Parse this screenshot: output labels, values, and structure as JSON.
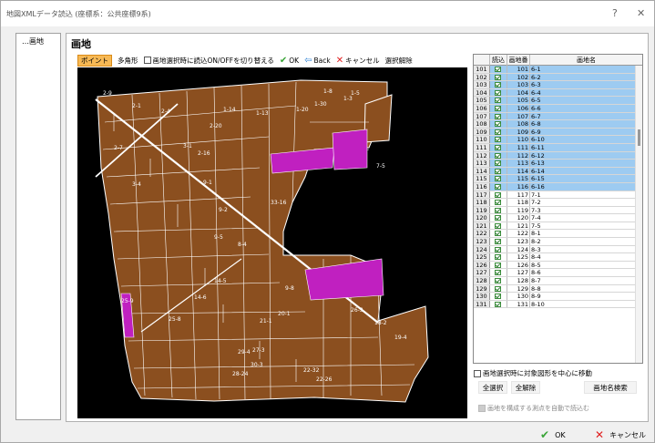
{
  "window": {
    "title": "地図XMLデータ読込 (座標系：公共座標9系)",
    "help_label": "?",
    "close_label": "✕"
  },
  "tree": {
    "item": "…画地"
  },
  "panel": {
    "title": "画地"
  },
  "toolbar": {
    "point": "ポイント",
    "polygon": "多角形",
    "toggle_label": "画地選択時に読込ON/OFFを切り替える",
    "ok": "OK",
    "back": "Back",
    "cancel": "キャンセル",
    "clear": "選択解除"
  },
  "grid": {
    "headers": [
      "読込",
      "画地番号",
      "画地名"
    ],
    "rows": [
      {
        "idx": "101",
        "num": "101",
        "name": "6-1",
        "sel": true
      },
      {
        "idx": "102",
        "num": "102",
        "name": "6-2",
        "sel": true
      },
      {
        "idx": "103",
        "num": "103",
        "name": "6-3",
        "sel": true
      },
      {
        "idx": "104",
        "num": "104",
        "name": "6-4",
        "sel": true
      },
      {
        "idx": "105",
        "num": "105",
        "name": "6-5",
        "sel": true
      },
      {
        "idx": "106",
        "num": "106",
        "name": "6-6",
        "sel": true
      },
      {
        "idx": "107",
        "num": "107",
        "name": "6-7",
        "sel": true
      },
      {
        "idx": "108",
        "num": "108",
        "name": "6-8",
        "sel": true
      },
      {
        "idx": "109",
        "num": "109",
        "name": "6-9",
        "sel": true
      },
      {
        "idx": "110",
        "num": "110",
        "name": "6-10",
        "sel": true
      },
      {
        "idx": "111",
        "num": "111",
        "name": "6-11",
        "sel": true
      },
      {
        "idx": "112",
        "num": "112",
        "name": "6-12",
        "sel": true
      },
      {
        "idx": "113",
        "num": "113",
        "name": "6-13",
        "sel": true
      },
      {
        "idx": "114",
        "num": "114",
        "name": "6-14",
        "sel": true
      },
      {
        "idx": "115",
        "num": "115",
        "name": "6-15",
        "sel": true
      },
      {
        "idx": "116",
        "num": "116",
        "name": "6-16",
        "sel": true
      },
      {
        "idx": "117",
        "num": "117",
        "name": "7-1",
        "sel": false
      },
      {
        "idx": "118",
        "num": "118",
        "name": "7-2",
        "sel": false
      },
      {
        "idx": "119",
        "num": "119",
        "name": "7-3",
        "sel": false
      },
      {
        "idx": "120",
        "num": "120",
        "name": "7-4",
        "sel": false
      },
      {
        "idx": "121",
        "num": "121",
        "name": "7-5",
        "sel": false
      },
      {
        "idx": "122",
        "num": "122",
        "name": "8-1",
        "sel": false
      },
      {
        "idx": "123",
        "num": "123",
        "name": "8-2",
        "sel": false
      },
      {
        "idx": "124",
        "num": "124",
        "name": "8-3",
        "sel": false
      },
      {
        "idx": "125",
        "num": "125",
        "name": "8-4",
        "sel": false
      },
      {
        "idx": "126",
        "num": "126",
        "name": "8-5",
        "sel": false
      },
      {
        "idx": "127",
        "num": "127",
        "name": "8-6",
        "sel": false
      },
      {
        "idx": "128",
        "num": "128",
        "name": "8-7",
        "sel": false
      },
      {
        "idx": "129",
        "num": "129",
        "name": "8-8",
        "sel": false
      },
      {
        "idx": "130",
        "num": "130",
        "name": "8-9",
        "sel": false
      },
      {
        "idx": "131",
        "num": "131",
        "name": "8-10",
        "sel": false
      }
    ]
  },
  "options": {
    "center_label": "画地選択時に対象図形を中心に移動",
    "select_all": "全選択",
    "deselect_all": "全解除",
    "search": "画地名検索",
    "auto_read": "画地を構成する測点を自動で読込む"
  },
  "footer": {
    "ok": "OK",
    "cancel": "キャンセル"
  },
  "map_labels": [
    "2-9",
    "2-1",
    "1-14",
    "1-13",
    "1-20",
    "1-30",
    "1-3",
    "1-8",
    "1-5",
    "2-7",
    "2-20",
    "2-16",
    "2-4",
    "3-1",
    "3-4",
    "9-1",
    "9-2",
    "9-5",
    "8-4",
    "14-6",
    "14-5",
    "9-8",
    "7-5",
    "25-8",
    "25-9",
    "21-1",
    "20-1",
    "19-4",
    "18-2",
    "29-4",
    "30-3",
    "28-24",
    "22-32",
    "33-16",
    "26-3",
    "27-3",
    "22-26"
  ]
}
